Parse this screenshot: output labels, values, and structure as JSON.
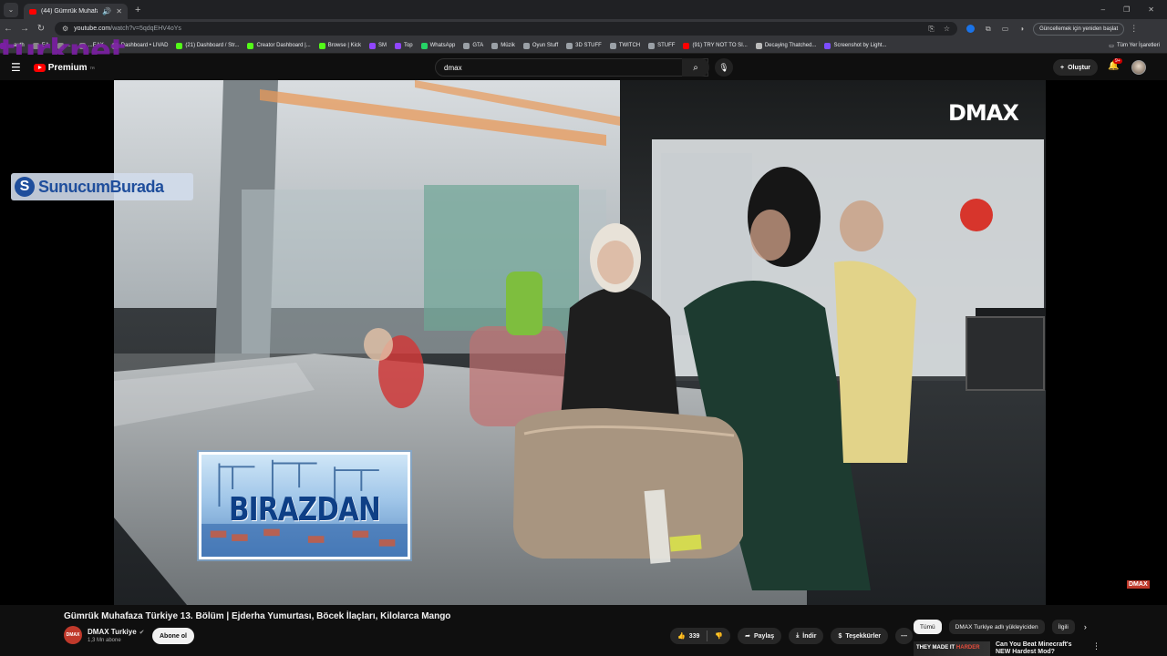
{
  "browser": {
    "tab": {
      "title": "(44) Gümrük Muhafaza Türk..."
    },
    "url": {
      "host": "youtube.com",
      "path": "/watch?v=5qdqEHV4oYs"
    },
    "update_label": "Güncellemek için yeniden başlat",
    "bookmarks": [
      {
        "label": "...auth",
        "color": "#7a1fa2"
      },
      {
        "label": "EA",
        "color": "#888888"
      },
      {
        "label": "...",
        "color": "#888888"
      },
      {
        "label": "...EAX",
        "color": "#888888"
      },
      {
        "label": "Dashboard • LIVAD",
        "color": "#9e9e9e"
      },
      {
        "label": "(21) Dashboard / Str...",
        "color": "#53fc18"
      },
      {
        "label": "Creator Dashboard |...",
        "color": "#53fc18"
      },
      {
        "label": "Browse | Kick",
        "color": "#53fc18"
      },
      {
        "label": "SM",
        "color": "#9146ff"
      },
      {
        "label": "Top",
        "color": "#9146ff"
      },
      {
        "label": "WhatsApp",
        "color": "#25d366"
      },
      {
        "label": "GTA",
        "color": "#9aa0a6"
      },
      {
        "label": "Müzik",
        "color": "#9aa0a6"
      },
      {
        "label": "Oyun Stuff",
        "color": "#9aa0a6"
      },
      {
        "label": "3D STUFF",
        "color": "#9aa0a6"
      },
      {
        "label": "TWITCH",
        "color": "#9aa0a6"
      },
      {
        "label": "STUFF",
        "color": "#9aa0a6"
      },
      {
        "label": "(91) TRY NOT TO SI...",
        "color": "#ff0000"
      },
      {
        "label": "Decaying Thatched...",
        "color": "#bbbbbb"
      },
      {
        "label": "Screenshot by Light...",
        "color": "#7c4dff"
      }
    ],
    "all_bookmarks": "Tüm Yer İşaretleri",
    "watermark": "turknet"
  },
  "youtube": {
    "logo": "Premium",
    "logo_sup": "TR",
    "search_value": "dmax",
    "create_label": "Oluştur",
    "notif_count": "9+",
    "video": {
      "overlay_left": {
        "s": "S",
        "part1": "Sunucum",
        "part2": "Burada"
      },
      "channel_logo": "DMAX",
      "promo_word": "BIRAZDAN",
      "small_logo": "DMAX"
    },
    "title": "Gümrük Muhafaza Türkiye 13. Bölüm | Ejderha Yumurtası, Böcek İlaçları, Kilolarca Mango",
    "channel": {
      "name": "DMAX Turkiye",
      "avatar_text": "DMAX",
      "subs": "1,3 Mn abone"
    },
    "subscribe": "Abone ol",
    "actions": {
      "likes": "339",
      "share": "Paylaş",
      "download": "İndir",
      "thanks": "Teşekkürler"
    },
    "chips": [
      "Tümü",
      "DMAX Turkiye adlı yükleyiciden",
      "İlgili"
    ],
    "rec": {
      "thumb_text_a": "THEY MADE IT ",
      "thumb_text_b": "HARDER",
      "title": "Can You Beat Minecraft's NEW Hardest Mod?"
    }
  }
}
